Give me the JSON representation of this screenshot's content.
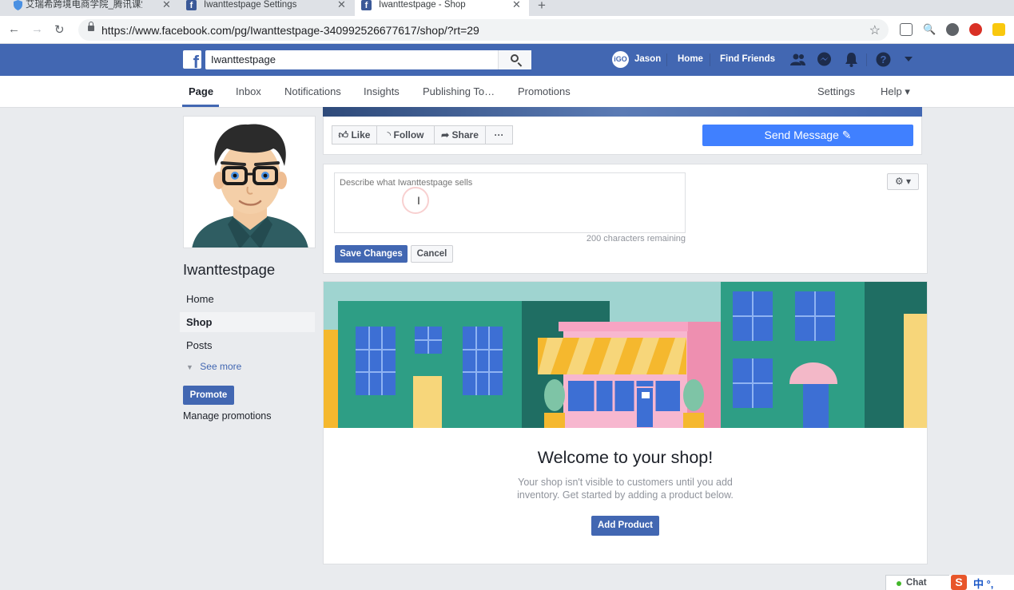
{
  "browser": {
    "tabs": [
      {
        "title": "艾瑞希跨境电商学院_腾讯课堂",
        "active": false
      },
      {
        "title": "Iwanttestpage Settings",
        "active": false
      },
      {
        "title": "Iwanttestpage - Shop",
        "active": true
      }
    ],
    "url": "https://www.facebook.com/pg/Iwanttestpage-340992526677617/shop/?rt=29"
  },
  "fb_header": {
    "search_value": "Iwanttestpage",
    "user_name": "Jason",
    "avatar_text": "iGO",
    "home": "Home",
    "find_friends": "Find Friends"
  },
  "page_tabs": [
    "Page",
    "Inbox",
    "Notifications",
    "Insights",
    "Publishing To…",
    "Promotions"
  ],
  "right_tabs": {
    "settings": "Settings",
    "help": "Help ▾"
  },
  "page_name": "Iwanttestpage",
  "left_nav": [
    "Home",
    "Shop",
    "Posts"
  ],
  "see_more": "See more",
  "promote": "Promote",
  "manage_promotions": "Manage promotions",
  "actions": {
    "like": "Like",
    "follow": "Follow",
    "share": "Share",
    "more": "···",
    "send_message": "Send Message"
  },
  "shop_description": {
    "placeholder": "Describe what Iwanttestpage sells",
    "chars_remaining": "200 characters remaining",
    "save": "Save Changes",
    "cancel": "Cancel",
    "gear": "⚙ ▾"
  },
  "welcome": {
    "title": "Welcome to your shop!",
    "line1": "Your shop isn't visible to customers until you add",
    "line2": "inventory. Get started by adding a product below.",
    "add_product": "Add Product"
  },
  "chat": "Chat",
  "ime": "中 °,"
}
